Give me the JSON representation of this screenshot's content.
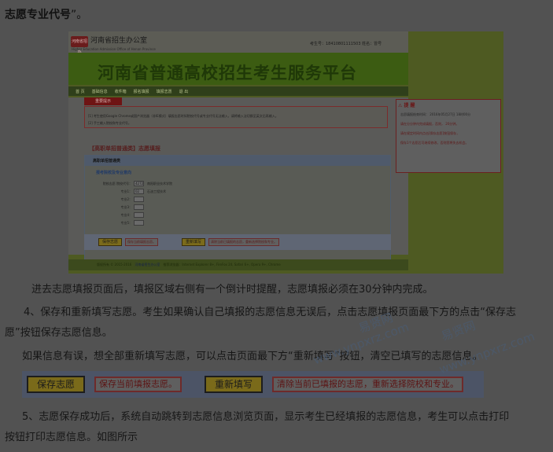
{
  "heading": {
    "text": "志愿专业代号",
    "quote": "”。"
  },
  "shot": {
    "office_logo_text": "河南省招办",
    "office_name": "河南省招生办公室",
    "office_sub": "Higher Education Admission Office of Henan Province",
    "user_line": "考生号：18410801111503    姓名：冒号",
    "banner_title": "河南省普通高校招生考生服务平台",
    "nav": [
      "首 页",
      "基础信息",
      "收件箱",
      "报名填报",
      "填报志愿",
      "退 出"
    ],
    "notice_tag": "重要提示",
    "notice_lines": [
      "[1] 考生使用Google Chrome或国产浏览器（非IE模式）填报志愿时如院校代号或专业代号无法输入，请将输入法切换至英文后再输入。",
      "[2] 手工输入院校和专业代号。"
    ],
    "form_title": "【高职单招普通类】志愿填报",
    "panel_head": "高职单招普通类",
    "panel_section": "报考院校及专业意向",
    "college_label": "院校志愿  院校代号：",
    "college_code": "4272",
    "college_name": "南阳职业技术学院",
    "majors": [
      {
        "label": "专业1：",
        "code": "02",
        "name": "石油工程技术"
      },
      {
        "label": "专业2：",
        "code": "",
        "name": ""
      },
      {
        "label": "专业3：",
        "code": "",
        "name": ""
      },
      {
        "label": "专业4：",
        "code": "",
        "name": ""
      },
      {
        "label": "专业5：",
        "code": "",
        "name": ""
      }
    ],
    "save_btn": "保存志愿",
    "save_note": "保存当前填报志愿。",
    "reset_btn": "重新填写",
    "reset_note": "清除当前已填报的志愿，重新选择院校和专业。",
    "footer_copy": "版权所有 © 2015-2016",
    "footer_org": "河南省招生办公室",
    "footer_browser": "推荐浏览器：Internet Explorer 8+, FireFox 24, Safari 6+, Opera 9+, Chrome",
    "tip_title": "提 醒",
    "tip_lines": [
      "志愿填报结束时间：   2016年05月27日  18时00分",
      "请在分分钟内完成填报，否则，   20分钟。",
      "请在规定时间内点击[保存志愿]按钮保存，",
      "保存1个志愿后可继续修改，否则您将失去机会。"
    ]
  },
  "paragraphs": {
    "p1": "进去志愿填报页面后，填报区域右侧有一个倒计时提醒，志愿填报必须在30分钟内完成。",
    "p2a": "4、保存和重新填写志愿。考生如果确认自己填报的志愿信息无误后，点击志愿填报页面最下方的点击“保存志",
    "p2b": "愿”按钮保存志愿信息。",
    "p3": "如果信息有误，想全部重新填写志愿，可以点击页面最下方“重新填写”按钮，清空已填写的志愿信息。",
    "p4a": "5、志愿保存成功后，系统自动跳转到志愿信息浏览页面，显示考生已经填报的志愿信息，考生可以点击打印",
    "p4b": "按钮打印志愿信息。如图所示"
  },
  "bottom_buttons": {
    "save_btn": "保存志愿",
    "save_note": "保存当前填报志愿。",
    "reset_btn": "重新填写",
    "reset_note": "清除当前已填报的志愿，重新选择院校和专业。"
  },
  "watermarks": {
    "w1": "易贤网",
    "w2": "www.ynpxrz.com",
    "w3": "易贤网",
    "w4": "www.ynpxrz.com"
  },
  "colors": {
    "overlay": "#525252",
    "banner_green": "#3c5c12",
    "button_yellow": "#7a6a1a",
    "note_red": "#5c1414"
  }
}
